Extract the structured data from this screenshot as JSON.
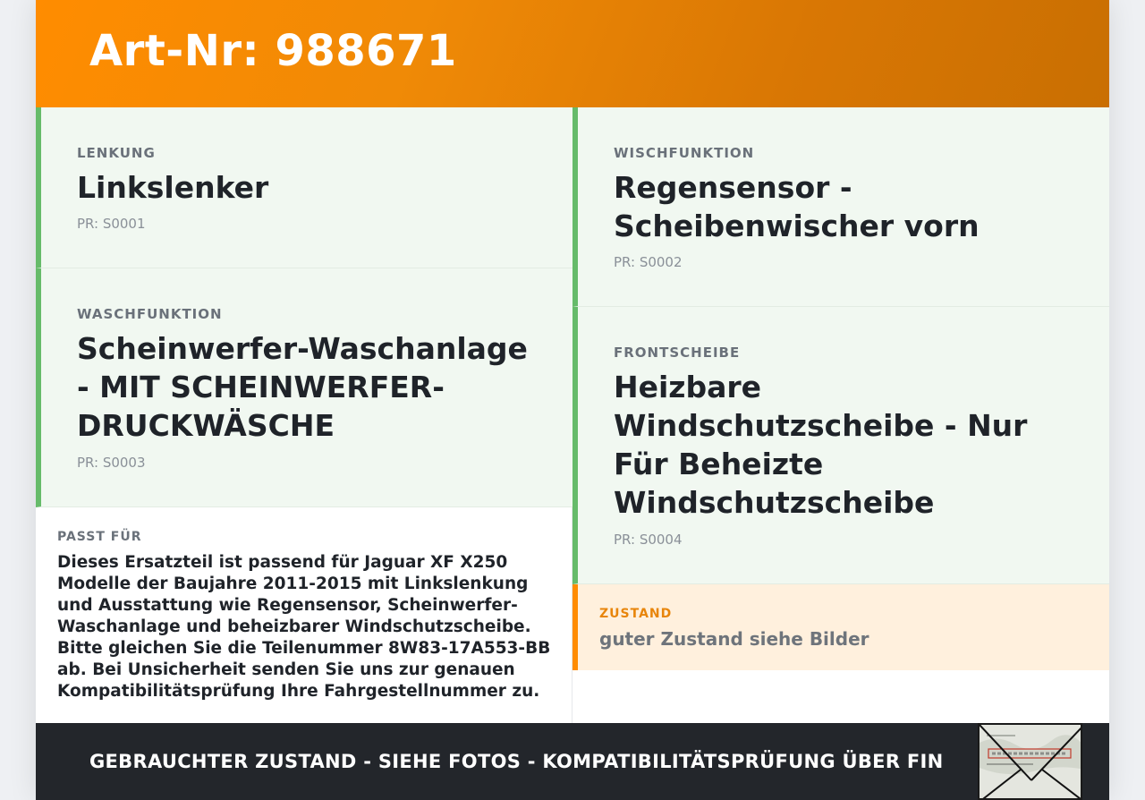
{
  "header": {
    "title": "Art-Nr: 988671"
  },
  "features": [
    {
      "label": "LENKUNG",
      "value": "Linkslenker",
      "pr": "PR: S0001"
    },
    {
      "label": "WISCHFUNKTION",
      "value": "Regensensor - Scheibenwischer vorn",
      "pr": "PR: S0002"
    },
    {
      "label": "WASCHFUNKTION",
      "value": "Scheinwerfer-Waschanlage - MIT SCHEINWERFER-DRUCKWÄSCHE",
      "pr": "PR: S0003"
    },
    {
      "label": "FRONTSCHEIBE",
      "value": "Heizbare Windschutzscheibe - Nur Für Beheizte Windschutzscheibe",
      "pr": "PR: S0004"
    }
  ],
  "fits": {
    "label": "PASST FÜR",
    "text": "Dieses Ersatzteil ist passend für Jaguar XF X250 Modelle der Baujahre 2011-2015 mit Linkslenkung und Ausstattung wie Regensensor, Scheinwerfer-Waschanlage und beheizbarer Windschutzscheibe. Bitte gleichen Sie die Teilenummer 8W83-17A553-BB ab. Bei Unsicherheit senden Sie uns zur genauen Kompatibilitätsprüfung Ihre Fahrgestellnummer zu."
  },
  "condition": {
    "label": "ZUSTAND",
    "text": "guter Zustand siehe Bilder"
  },
  "footer": {
    "text": "GEBRAUCHTER ZUSTAND - SIEHE FOTOS - KOMPATIBILITÄTSPRÜFUNG ÜBER FIN",
    "thumbnail": {
      "icon": "vehicle-document-photo-icon"
    }
  },
  "colors": {
    "accent": "#ff8c00",
    "feature_bg": "#f1f8f1",
    "feature_border": "#66bb6a",
    "condition_bg": "#fff0dd",
    "footer_bg": "#23262b"
  }
}
